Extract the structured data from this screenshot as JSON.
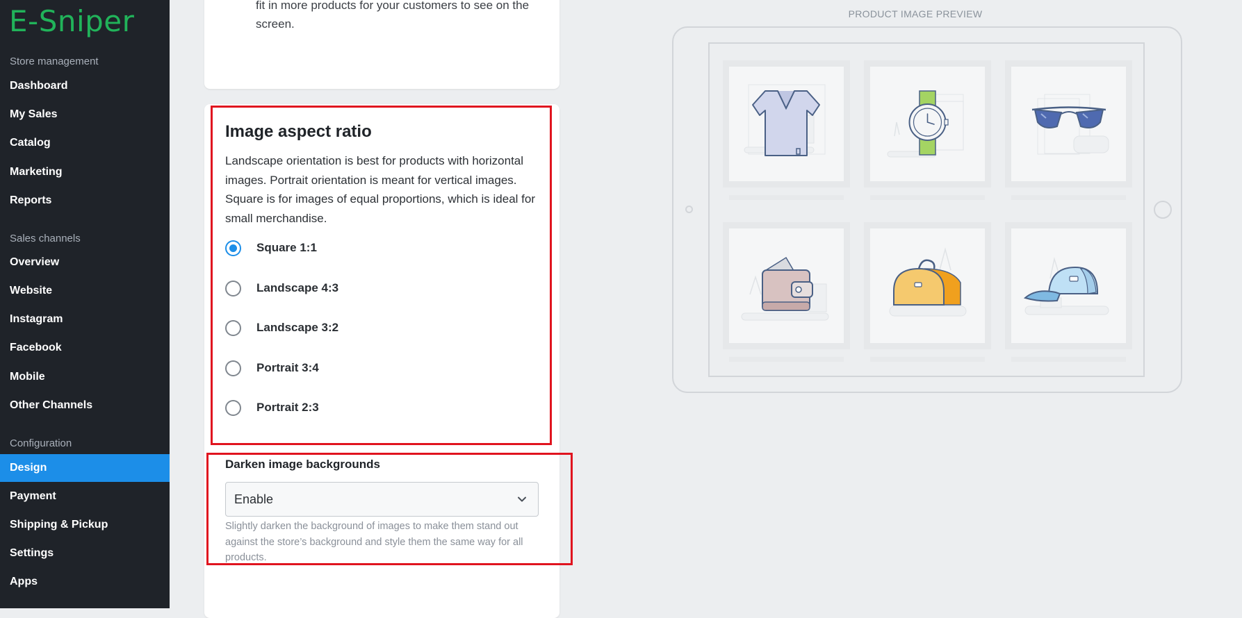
{
  "sidebar": {
    "logo": "E-Sniper",
    "sections": [
      {
        "label": "Store management"
      },
      {
        "label": "Sales channels"
      },
      {
        "label": "Configuration"
      }
    ],
    "items": [
      {
        "label": "Dashboard"
      },
      {
        "label": "My Sales"
      },
      {
        "label": "Catalog"
      },
      {
        "label": "Marketing"
      },
      {
        "label": "Reports"
      },
      {
        "label": "Overview"
      },
      {
        "label": "Website"
      },
      {
        "label": "Instagram"
      },
      {
        "label": "Facebook"
      },
      {
        "label": "Mobile"
      },
      {
        "label": "Other Channels"
      },
      {
        "label": "Design",
        "active": true
      },
      {
        "label": "Payment"
      },
      {
        "label": "Shipping & Pickup"
      },
      {
        "label": "Settings"
      },
      {
        "label": "Apps"
      }
    ],
    "accent_color": "#1c8ee8",
    "background_color": "#1f2329"
  },
  "top_card": {
    "text": "fit in more products for your customers to see on the screen."
  },
  "aspect_ratio": {
    "title": "Image aspect ratio",
    "description": "Landscape orientation is best for products with horizontal images. Portrait orientation is meant for vertical images. Square is for images of equal proportions, which is ideal for small merchandise.",
    "options": [
      {
        "label": "Square 1:1",
        "checked": true
      },
      {
        "label": "Landscape 4:3",
        "checked": false
      },
      {
        "label": "Landscape 3:2",
        "checked": false
      },
      {
        "label": "Portrait 3:4",
        "checked": false
      },
      {
        "label": "Portrait 2:3",
        "checked": false
      }
    ]
  },
  "darken": {
    "label": "Darken image backgrounds",
    "selected": "Enable",
    "hint": "Slightly darken the background of images to make them stand out against the store’s background and style them the same way for all products."
  },
  "preview": {
    "label": "PRODUCT IMAGE PREVIEW",
    "products": [
      {
        "icon": "tshirt-icon"
      },
      {
        "icon": "watch-icon"
      },
      {
        "icon": "sunglasses-icon"
      },
      {
        "icon": "wallet-icon"
      },
      {
        "icon": "bag-icon"
      },
      {
        "icon": "cap-icon"
      }
    ]
  },
  "highlight_color": "#e0141f"
}
